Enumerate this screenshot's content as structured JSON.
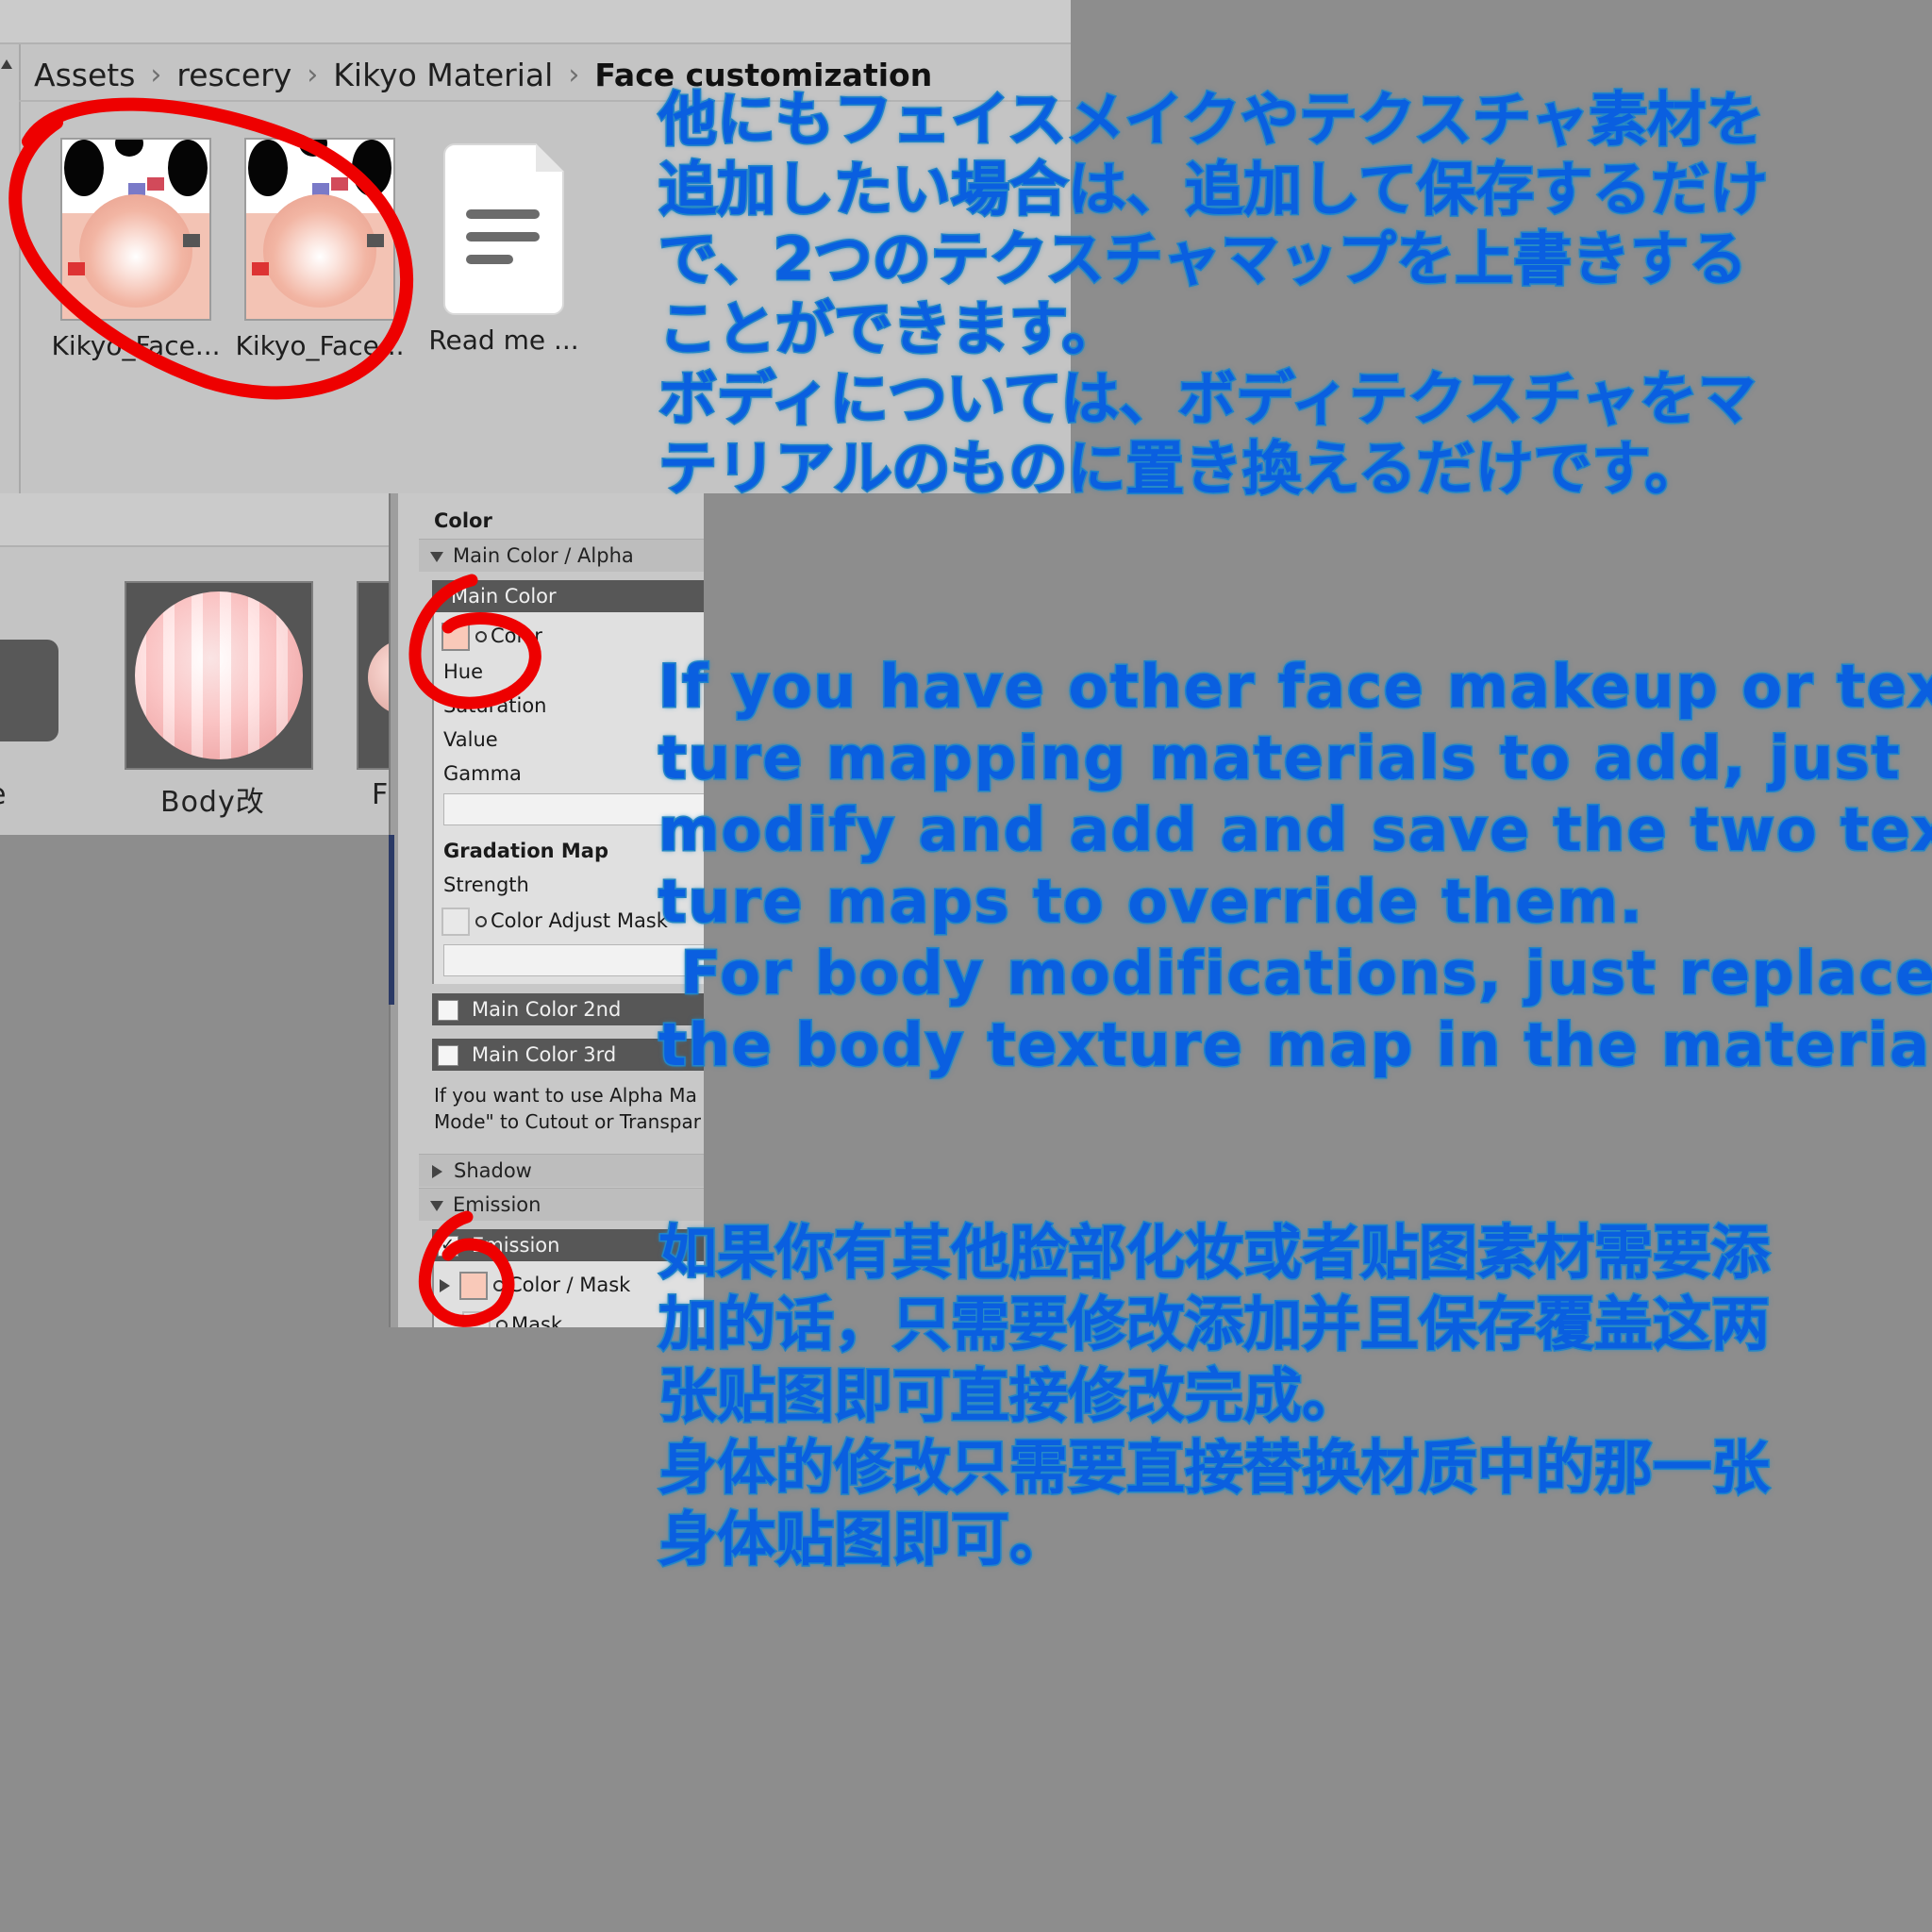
{
  "breadcrumb": [
    "Assets",
    "rescery",
    "Kikyo Material",
    "Face customization"
  ],
  "assets": [
    {
      "label": "Kikyo_Face..."
    },
    {
      "label": "Kikyo_Face..."
    },
    {
      "label": "Read me ..."
    }
  ],
  "materials": {
    "body_label": "Body改",
    "next_label_partial": "F",
    "prev_label_partial": "e"
  },
  "inspector": {
    "color_header": "Color",
    "main_color_alpha": "Main Color / Alpha",
    "main_color": "Main Color",
    "color_prop": "Color",
    "hue": "Hue",
    "saturation": "Saturation",
    "value": "Value",
    "gamma": "Gamma",
    "gradation_map": "Gradation Map",
    "strength": "Strength",
    "color_adjust_mask": "Color Adjust Mask",
    "main_color_2nd": "Main Color 2nd",
    "main_color_3rd": "Main Color 3rd",
    "alpha_note_1": "If you want to use Alpha Ma",
    "alpha_note_2": "Mode\" to Cutout or Transpar",
    "shadow": "Shadow",
    "emission_section": "Emission",
    "emission_toggle": "Emission",
    "color_mask": "Color / Mask",
    "mask": "Mask"
  },
  "captions": {
    "japanese": [
      "他にもフェイスメイクやテクスチャ素材を",
      "追加したい場合は、追加して保存するだけ",
      "で、2つのテクスチャマップを上書きする",
      "ことができます。",
      "ボディについては、ボディテクスチャをマ",
      "テリアルのものに置き換えるだけです。"
    ],
    "english": [
      "If you have other face makeup or tex-",
      "ture mapping materials to add, just",
      "modify and add and save the two tex-",
      "ture maps to override them.",
      " For body modifications, just replace",
      "the body texture map in the material."
    ],
    "chinese": [
      "如果你有其他脸部化妆或者贴图素材需要添",
      "加的话，只需要修改添加并且保存覆盖这两",
      "张贴图即可直接修改完成。",
      "身体的修改只需要直接替换材质中的那一张",
      "身体贴图即可。"
    ]
  },
  "colors": {
    "caption_fill": "#0a5fe0",
    "caption_outline": "#1e7fc4",
    "annotation_red": "#ee0000",
    "background": "#8d8d8d"
  }
}
